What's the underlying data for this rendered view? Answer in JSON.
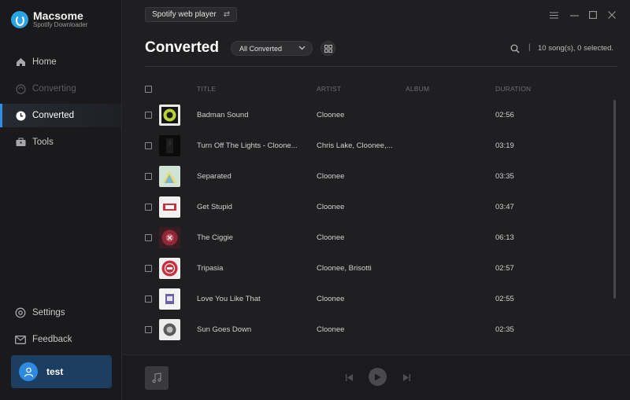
{
  "app": {
    "name": "Macsome",
    "subtitle": "Spotify Downloader",
    "accent": "#2f8fe8"
  },
  "sidebar": {
    "items": [
      {
        "label": "Home",
        "icon": "home-icon",
        "state": "normal"
      },
      {
        "label": "Converting",
        "icon": "converting-icon",
        "state": "disabled"
      },
      {
        "label": "Converted",
        "icon": "clock-icon",
        "state": "active"
      },
      {
        "label": "Tools",
        "icon": "toolbox-icon",
        "state": "normal"
      }
    ],
    "bottom": [
      {
        "label": "Settings",
        "icon": "gear-icon"
      },
      {
        "label": "Feedback",
        "icon": "mail-icon"
      }
    ],
    "user": {
      "name": "test"
    }
  },
  "header": {
    "source_button": "Spotify web player",
    "page_title": "Converted",
    "filter_value": "All Converted",
    "separator": "|",
    "count_text": "10 song(s), 0 selected."
  },
  "table": {
    "columns": [
      "TITLE",
      "ARTIST",
      "ALBUM",
      "DURATION"
    ],
    "rows": [
      {
        "title": "Badman Sound",
        "artist": "Cloonee",
        "album": "",
        "duration": "02:56"
      },
      {
        "title": "Turn Off The Lights - Cloone...",
        "artist": "Chris Lake, Cloonee,...",
        "album": "",
        "duration": "03:19"
      },
      {
        "title": "Separated",
        "artist": "Cloonee",
        "album": "",
        "duration": "03:35"
      },
      {
        "title": "Get Stupid",
        "artist": "Cloonee",
        "album": "",
        "duration": "03:47"
      },
      {
        "title": "The Ciggie",
        "artist": "Cloonee",
        "album": "",
        "duration": "06:13"
      },
      {
        "title": "Tripasia",
        "artist": "Cloonee, Brisotti",
        "album": "",
        "duration": "02:57"
      },
      {
        "title": "Love You Like That",
        "artist": "Cloonee",
        "album": "",
        "duration": "02:55"
      },
      {
        "title": "Sun Goes Down",
        "artist": "Cloonee",
        "album": "",
        "duration": "02:35"
      }
    ]
  }
}
